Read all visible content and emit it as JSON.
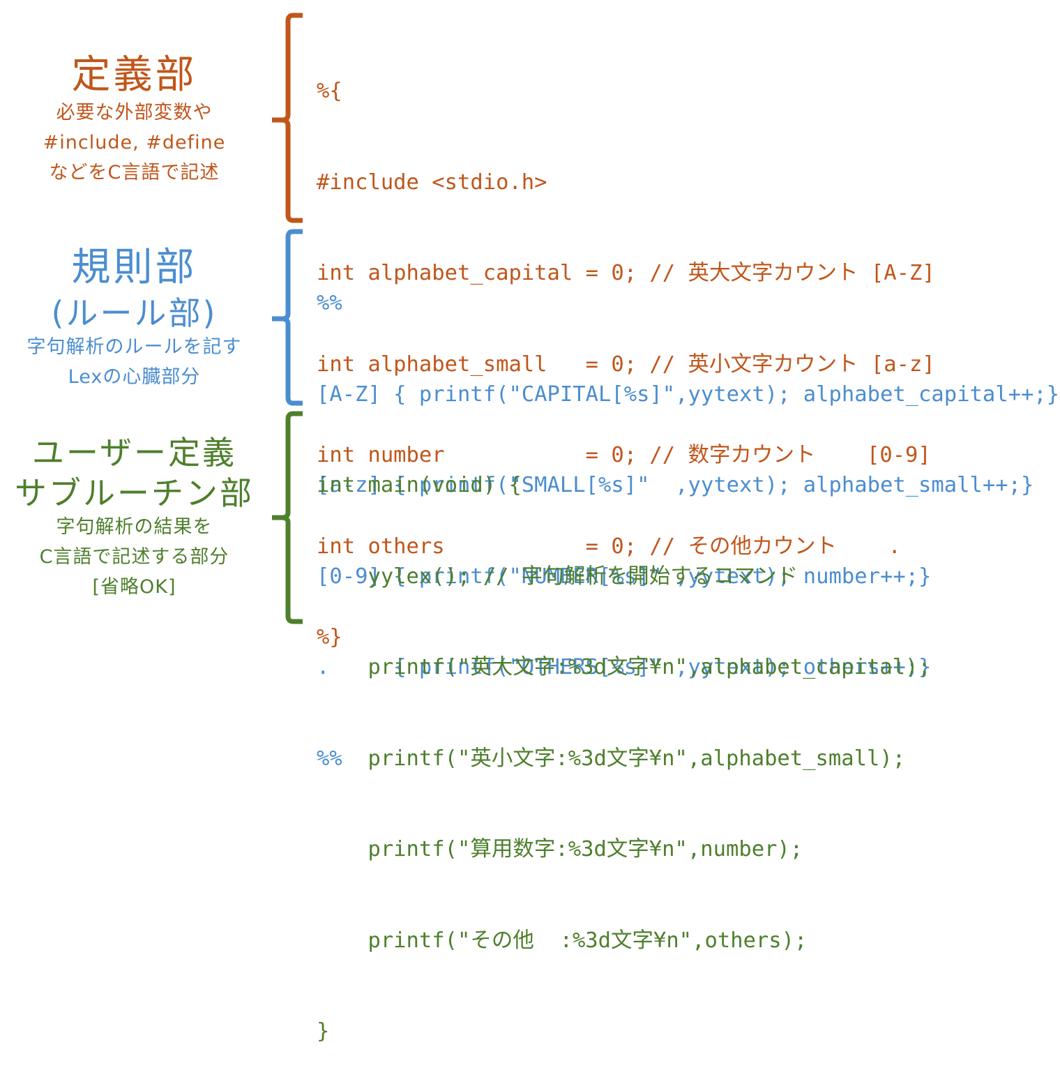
{
  "colors": {
    "definitions": "#c0561b",
    "rules": "#4b8dd0",
    "user_code": "#4e7f2d"
  },
  "sections": {
    "definitions": {
      "title": "定義部",
      "desc": [
        "必要な外部変数や",
        "#include, #define",
        "などをC言語で記述"
      ],
      "code": [
        "%{",
        "#include <stdio.h>",
        "int alphabet_capital = 0; // 英大文字カウント [A-Z]",
        "int alphabet_small   = 0; // 英小文字カウント [a-z]",
        "int number           = 0; // 数字カウント    [0-9]",
        "int others           = 0; // その他カウント    .",
        "%}"
      ]
    },
    "rules": {
      "title": "規則部",
      "subtitle": "(ルール部)",
      "desc": [
        "字句解析のルールを記す",
        "Lexの心臓部分"
      ],
      "code": [
        "%%",
        "[A-Z] { printf(\"CAPITAL[%s]\",yytext); alphabet_capital++;}",
        "[a-z] { printf(\"SMALL[%s]\"  ,yytext); alphabet_small++;}",
        "[0-9] { printf(\"NUMBER[%s]\" ,yytext); number++;}",
        ".     { printf(\"OTHERS[%s]\" ,yytext); others++;}",
        "%%"
      ]
    },
    "user_code": {
      "title_lines": [
        "ユーザー定義",
        "サブルーチン部"
      ],
      "desc": [
        "字句解析の結果を",
        "C言語で記述する部分",
        "[省略OK]"
      ],
      "code": [
        "int main(void) {",
        "    yylex(); // 字句解析を開始するコマンド",
        "    printf(\"英大文字:%3d文字¥n\",alphabet_capital);",
        "    printf(\"英小文字:%3d文字¥n\",alphabet_small);",
        "    printf(\"算用数字:%3d文字¥n\",number);",
        "    printf(\"その他  :%3d文字¥n\",others);",
        "}"
      ]
    }
  }
}
